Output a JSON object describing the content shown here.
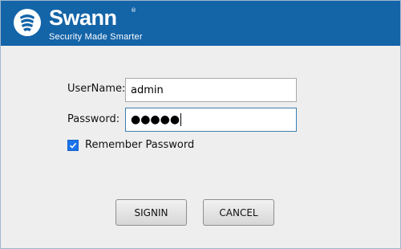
{
  "brand": {
    "name": "Swann",
    "registered": "®",
    "tagline": "Security Made Smarter"
  },
  "form": {
    "username_label": "UserName:",
    "username_value": "admin",
    "password_label": "Password:",
    "password_masked": "●●●●●",
    "remember_label": "Remember Password",
    "remember_checked": true
  },
  "buttons": {
    "signin": "SIGNIN",
    "cancel": "CANCEL"
  },
  "colors": {
    "header": "#1464a8",
    "checkbox": "#1a73e8",
    "focus_border": "#3c7fb1"
  }
}
